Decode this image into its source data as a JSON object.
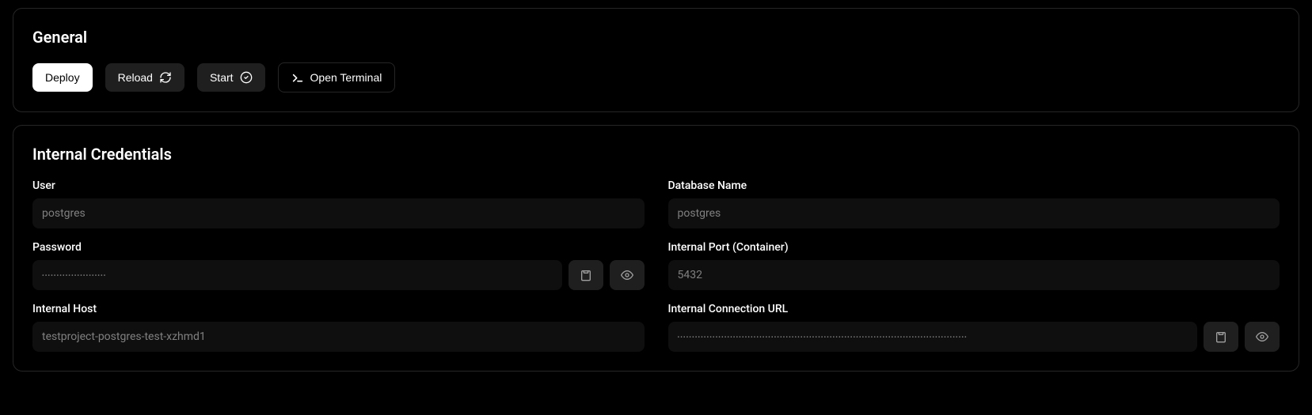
{
  "general": {
    "title": "General",
    "deploy_label": "Deploy",
    "reload_label": "Reload",
    "start_label": "Start",
    "open_terminal_label": "Open Terminal"
  },
  "credentials": {
    "title": "Internal Credentials",
    "user": {
      "label": "User",
      "value": "postgres"
    },
    "database_name": {
      "label": "Database Name",
      "value": "postgres"
    },
    "password": {
      "label": "Password",
      "masked": "••••••••••••••••••••••"
    },
    "internal_port": {
      "label": "Internal Port (Container)",
      "value": "5432"
    },
    "internal_host": {
      "label": "Internal Host",
      "value": "testproject-postgres-test-xzhmd1"
    },
    "internal_connection_url": {
      "label": "Internal Connection URL",
      "masked": "•••••••••••••••••••••••••••••••••••••••••••••••••••••••••••••••••••••••••••••••••••••••••••••••••••"
    }
  }
}
